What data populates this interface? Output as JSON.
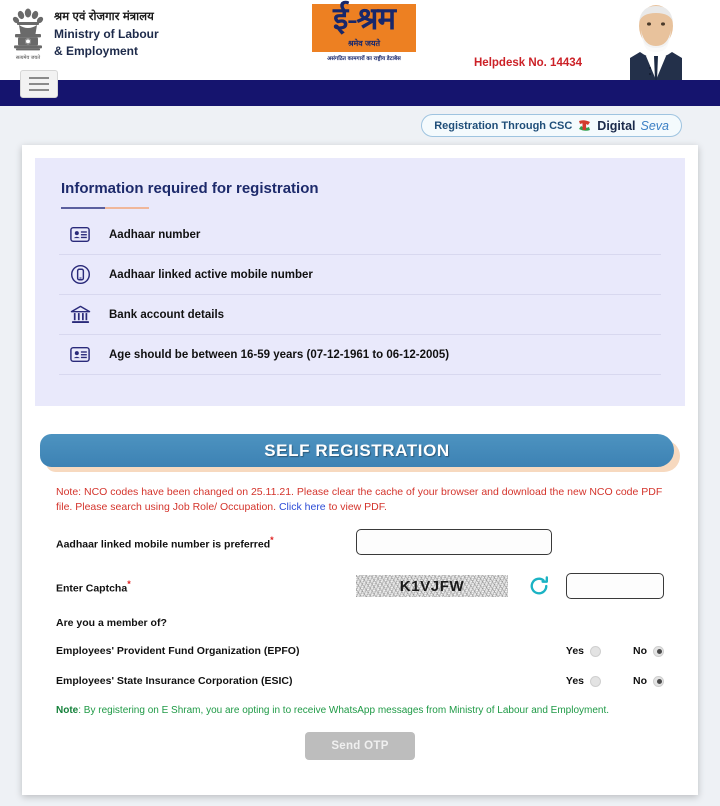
{
  "header": {
    "ministry_hi": "श्रम एवं रोजगार मंत्रालय",
    "ministry_en_l1": "Ministry of Labour",
    "ministry_en_l2": "& Employment",
    "emblem_motto": "सत्यमेव जयते",
    "logo_word": "ई-श्रम",
    "logo_sub": "श्रमेव जयते",
    "logo_tagline": "असंगठित कामगारों का राष्ट्रीय डेटाबेस",
    "helpdesk": "Helpdesk No. 14434"
  },
  "navbar": {
    "menu_icon": "hamburger-icon"
  },
  "csc_badge": {
    "label": "Registration Through CSC",
    "digital": "Digital",
    "seva": "Seva"
  },
  "info_panel": {
    "title": "Information required for registration",
    "items": [
      {
        "icon": "id-card-icon",
        "label": "Aadhaar number"
      },
      {
        "icon": "mobile-circle-icon",
        "label": "Aadhaar linked active mobile number"
      },
      {
        "icon": "bank-icon",
        "label": "Bank account details"
      },
      {
        "icon": "id-card-icon",
        "label": "Age should be between 16-59 years (07-12-1961 to 06-12-2005)"
      }
    ]
  },
  "banner": {
    "title": "SELF REGISTRATION"
  },
  "note": {
    "part1": "Note: NCO codes have been changed on 25.11.21. Please clear the cache of your browser and download the new NCO code PDF file. Please search using Job Role/ Occupation. ",
    "link": "Click here",
    "part2": " to view PDF."
  },
  "form": {
    "mobile_label": "Aadhaar linked mobile number is preferred",
    "mobile_value": "",
    "mobile_placeholder": "",
    "captcha_label": "Enter Captcha",
    "captcha_text": "K1VJFW",
    "refresh_icon": "refresh-icon",
    "captcha_value": "",
    "captcha_placeholder": "",
    "member_question": "Are you a member of?",
    "memberships": [
      {
        "label": "Employees' Provident Fund Organization (EPFO)",
        "yes_label": "Yes",
        "no_label": "No",
        "selected": "No"
      },
      {
        "label": "Employees' State Insurance Corporation (ESIC)",
        "yes_label": "Yes",
        "no_label": "No",
        "selected": "No"
      }
    ],
    "whatsapp_note_bold": "Note",
    "whatsapp_note_text": ": By registering on E Shram, you are opting in to receive WhatsApp messages from Ministry of Labour and Employment.",
    "submit_label": "Send OTP"
  },
  "colors": {
    "navbar": "#15146e",
    "brand_orange": "#ed8022",
    "brand_blue": "#18276b",
    "banner_blue": "#3d82b4",
    "note_red": "#d4342c",
    "link_blue": "#2b4bd6",
    "green_note": "#1f9a46",
    "helpdesk_red": "#cc2127",
    "panel_lavender": "#e9e9fb"
  }
}
